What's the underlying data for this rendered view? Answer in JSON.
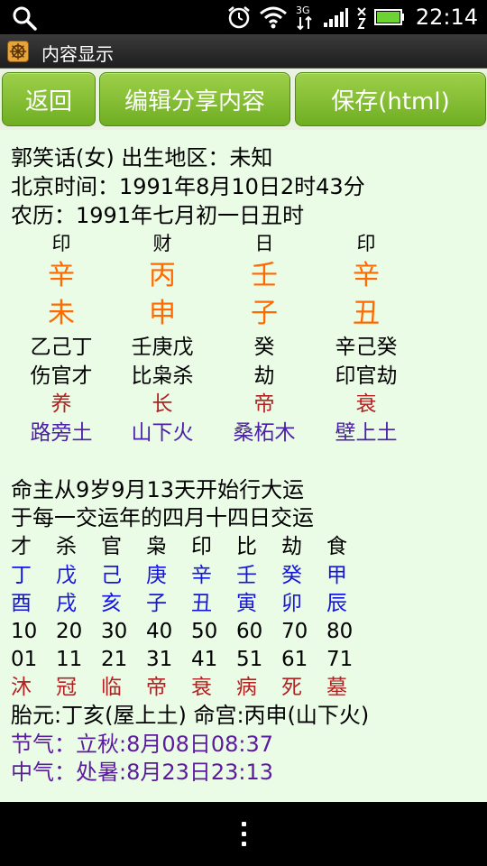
{
  "status": {
    "time": "22:14",
    "network": "3G"
  },
  "titlebar": {
    "title": "内容显示"
  },
  "toolbar": {
    "back_label": "返回",
    "edit_share_label": "编辑分享内容",
    "save_label": "保存(html)"
  },
  "info": {
    "line1": "郭笑话(女) 出生地区：未知",
    "line2": "北京时间：1991年8月10日2时43分",
    "line3": "农历：1991年七月初一日丑时"
  },
  "pillars": [
    {
      "god": "印",
      "stem": "辛",
      "branch": "未",
      "hidden": "乙己丁",
      "hidden_gods": "伤官才",
      "state": "养",
      "nayin": "路旁土"
    },
    {
      "god": "财",
      "stem": "丙",
      "branch": "申",
      "hidden": "壬庚戊",
      "hidden_gods": "比枭杀",
      "state": "长",
      "nayin": "山下火"
    },
    {
      "god": "日",
      "stem": "壬",
      "branch": "子",
      "hidden": "癸",
      "hidden_gods": "劫",
      "state": "帝",
      "nayin": "桑柘木"
    },
    {
      "god": "印",
      "stem": "辛",
      "branch": "丑",
      "hidden": "辛己癸",
      "hidden_gods": "印官劫",
      "state": "衰",
      "nayin": "壁上土"
    }
  ],
  "dayun": {
    "intro1": "命主从9岁9月13天开始行大运",
    "intro2": "于每一交运年的四月十四日交运",
    "gods": [
      "才",
      "杀",
      "官",
      "枭",
      "印",
      "比",
      "劫",
      "食"
    ],
    "stems": [
      "丁",
      "戊",
      "己",
      "庚",
      "辛",
      "壬",
      "癸",
      "甲"
    ],
    "branches": [
      "酉",
      "戌",
      "亥",
      "子",
      "丑",
      "寅",
      "卯",
      "辰"
    ],
    "ages": [
      "10",
      "20",
      "30",
      "40",
      "50",
      "60",
      "70",
      "80"
    ],
    "years": [
      "01",
      "11",
      "21",
      "31",
      "41",
      "51",
      "61",
      "71"
    ],
    "states": [
      "沐",
      "冠",
      "临",
      "帝",
      "衰",
      "病",
      "死",
      "墓"
    ]
  },
  "extra": {
    "taiyuan_minggong": "胎元:丁亥(屋上土) 命宫:丙申(山下火)",
    "jieqi": "节气：立秋:8月08日08:37",
    "zhongqi": "中气：处暑:8月23日23:13"
  }
}
